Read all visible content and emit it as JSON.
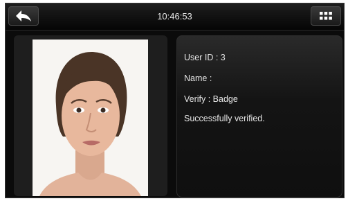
{
  "header": {
    "time": "10:46:53",
    "back_icon": "back-arrow-icon",
    "menu_icon": "grid-menu-icon"
  },
  "photo": {
    "subject": "face-photo"
  },
  "info": {
    "user_id": "User ID : 3",
    "name": "Name :",
    "verify": "Verify : Badge",
    "status": "Successfully verified."
  },
  "colors": {
    "background": "#0b0b0b",
    "panel": "#1e1e1e",
    "text": "#e6e6e6"
  }
}
